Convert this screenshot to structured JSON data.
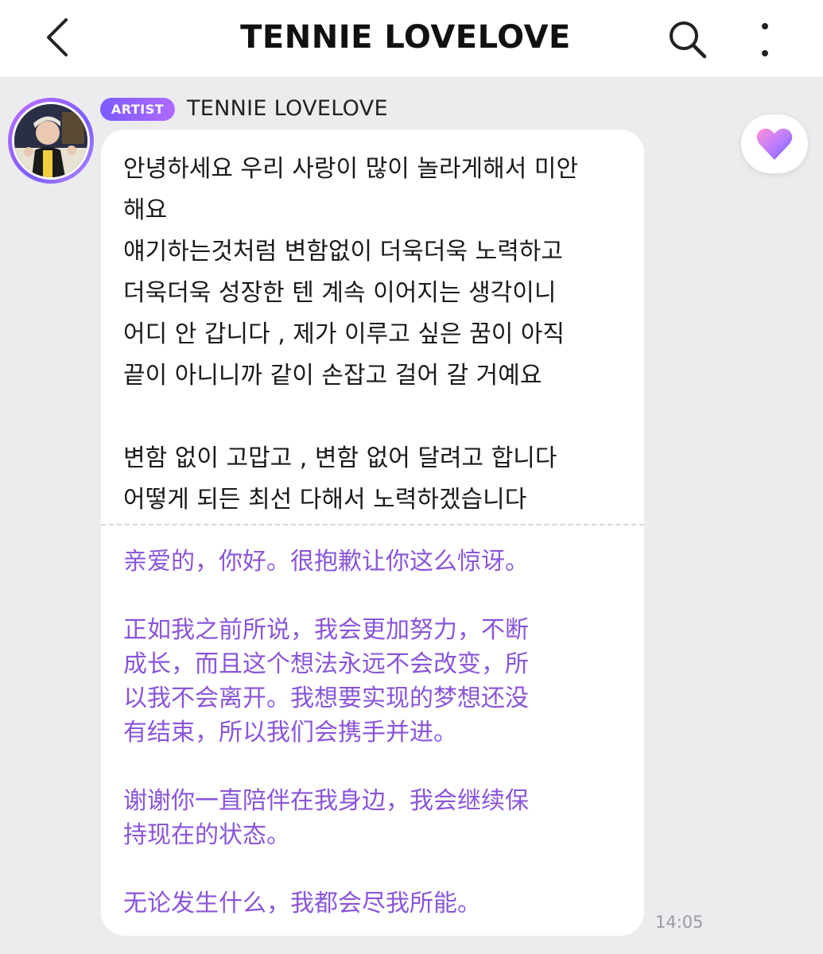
{
  "header": {
    "title": "TENNIE LOVELOVE",
    "back_icon": "chevron-left-icon",
    "search_icon": "search-icon",
    "more_icon": "more-vertical-icon"
  },
  "message": {
    "badge": "ARTIST",
    "sender": "TENNIE LOVELOVE",
    "avatar_icon": "avatar-photo",
    "korean_text": "안녕하세요 우리 사랑이 많이 놀라게해서 미안\n해요\n얘기하는것처럼 변함없이 더욱더욱 노력하고\n더욱더욱 성장한 텐 계속 이어지는 생각이니\n어디 안 갑니다 , 제가 이루고 싶은 꿈이 아직\n끝이 아니니까 같이 손잡고 걸어 갈 거예요\n\n변함 없이 고맙고 , 변함 없어 달려고 합니다\n어떻게 되든 최선 다해서 노력하겠습니다",
    "translation_text": "亲爱的，你好。很抱歉让你这么惊讶。\n\n正如我之前所说，我会更加努力，不断\n成长，而且这个想法永远不会改变，所\n以我不会离开。我想要实现的梦想还没\n有结束，所以我们会携手并进。\n\n谢谢你一直陪伴在我身边，我会继续保\n持现在的状态。\n\n无论发生什么，我都会尽我所能。",
    "time": "14:05",
    "reaction_icon": "heart-icon"
  },
  "colors": {
    "accent_purple": "#8a55d9",
    "badge_gradient_start": "#7b5cff",
    "badge_gradient_end": "#b069ff",
    "background": "#ececef"
  }
}
